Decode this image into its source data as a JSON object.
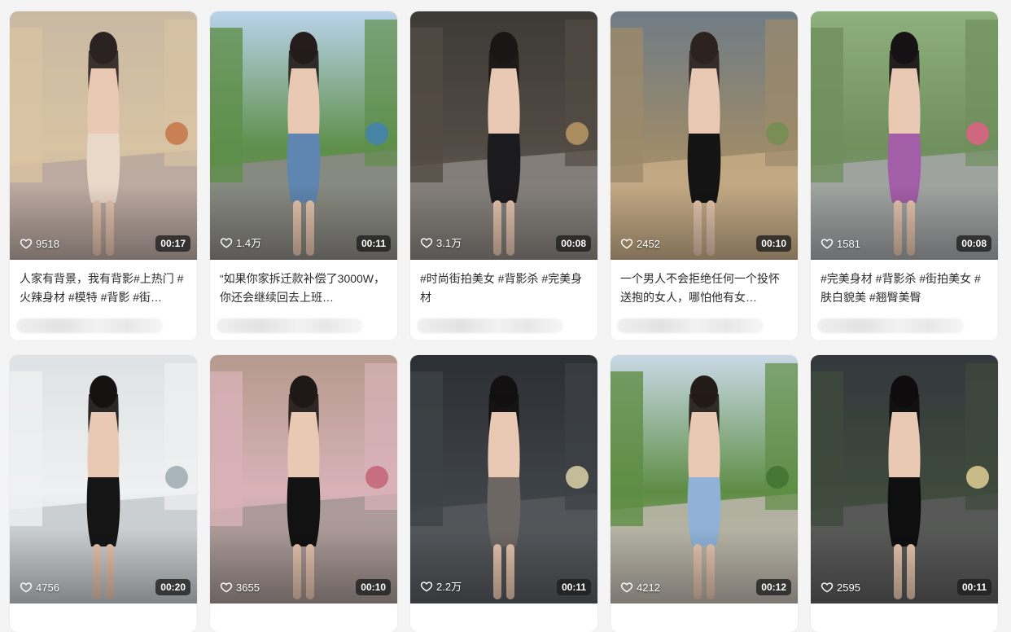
{
  "cards": [
    {
      "likes": "9518",
      "duration": "00:17",
      "title": "人家有背景，我有背影#上热门 #火辣身材 #模特 #背影 #街…",
      "scene": {
        "sky": "#c9b9a3",
        "ground": "#b9a7a0",
        "wall": "#d8c3a3",
        "accent": "#c46a3a",
        "outfit": "#e8d8c8",
        "hair": "#2a2220"
      }
    },
    {
      "likes": "1.4万",
      "duration": "00:11",
      "title": "“如果你家拆迁款补偿了3000W，你还会继续回去上班…",
      "scene": {
        "sky": "#b9d3ea",
        "ground": "#8c8a86",
        "wall": "#5e8f4a",
        "accent": "#3f7fc0",
        "outfit": "#5f86b0",
        "hair": "#231c1a"
      }
    },
    {
      "likes": "3.1万",
      "duration": "00:08",
      "title": "#时尚街拍美女 #背影杀 #完美身材",
      "scene": {
        "sky": "#3d3a36",
        "ground": "#8a8580",
        "wall": "#524b44",
        "accent": "#c7a36a",
        "outfit": "#1b1b1d",
        "hair": "#1a1616"
      }
    },
    {
      "likes": "2452",
      "duration": "00:10",
      "title": "一个男人不会拒绝任何一个投怀送抱的女人，哪怕他有女…",
      "scene": {
        "sky": "#6f7c86",
        "ground": "#c6ab86",
        "wall": "#9c8a6a",
        "accent": "#6c8f4c",
        "outfit": "#141414",
        "hair": "#2c2320"
      }
    },
    {
      "likes": "1581",
      "duration": "00:08",
      "title": "#完美身材 #背影杀 #街拍美女 #肤白貌美 #翘臀美臀",
      "scene": {
        "sky": "#8eb07c",
        "ground": "#a4a6a8",
        "wall": "#6f8f5c",
        "accent": "#ef5b8a",
        "outfit": "#a35ea8",
        "hair": "#161214"
      }
    },
    {
      "likes": "4756",
      "duration": "00:20",
      "title": "",
      "scene": {
        "sky": "#dfe2e4",
        "ground": "#c5cacd",
        "wall": "#eef0f1",
        "accent": "#93a2a8",
        "outfit": "#151515",
        "hair": "#151212"
      }
    },
    {
      "likes": "3655",
      "duration": "00:10",
      "title": "",
      "scene": {
        "sky": "#b59a8c",
        "ground": "#a49694",
        "wall": "#d8b2b8",
        "accent": "#c25a6e",
        "outfit": "#121212",
        "hair": "#1e1817"
      }
    },
    {
      "likes": "2.2万",
      "duration": "00:11",
      "title": "",
      "scene": {
        "sky": "#2c2f33",
        "ground": "#55585c",
        "wall": "#3d4246",
        "accent": "#f2e6b4",
        "outfit": "#6d6764",
        "hair": "#121010"
      }
    },
    {
      "likes": "4212",
      "duration": "00:12",
      "title": "",
      "scene": {
        "sky": "#c9d9e6",
        "ground": "#bdb6ad",
        "wall": "#5e8d45",
        "accent": "#3e6e2e",
        "outfit": "#8fb2d6",
        "hair": "#231b18"
      }
    },
    {
      "likes": "2595",
      "duration": "00:11",
      "title": "",
      "scene": {
        "sky": "#34383c",
        "ground": "#5a5a5a",
        "wall": "#3e4a3c",
        "accent": "#f7e2a0",
        "outfit": "#0f0f10",
        "hair": "#0e0c0c"
      }
    }
  ]
}
